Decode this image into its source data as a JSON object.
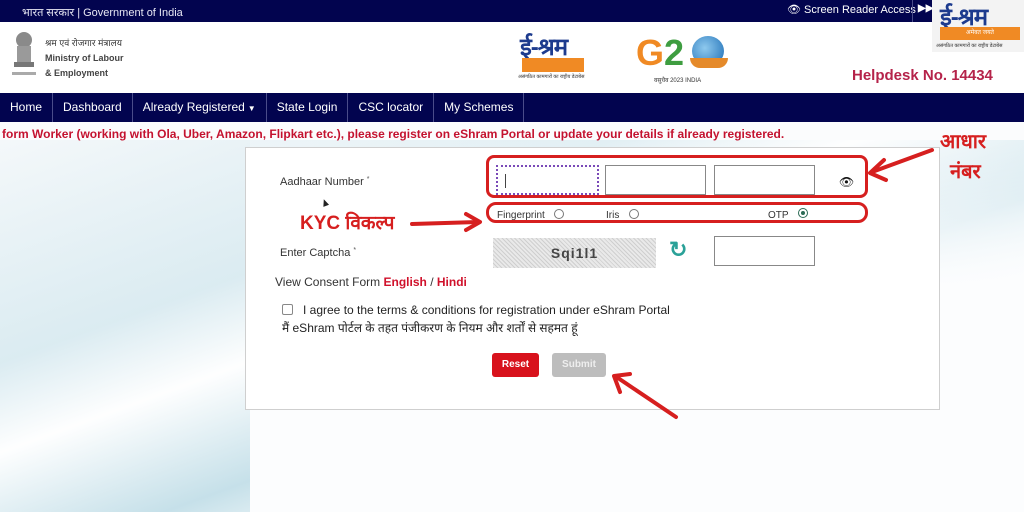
{
  "topbar": {
    "govt_label": "भारत सरकार | Government of India",
    "screen_reader_label": "Screen Reader Access",
    "skip_icon": "skip-forward-icon"
  },
  "header": {
    "ministry_hi": "श्रम एवं रोजगार मंत्रालय",
    "ministry_en_line1": "Ministry of Labour",
    "ministry_en_line2": "& Employment",
    "eshram_logo_text": "ई-श्रम",
    "eshram_tagline": "अमेवत जयते",
    "eshram_subtitle": "असंगठित कामगारों का राष्ट्रीय डेटाबेस",
    "g20_year": "वसुधैव 2023 INDIA",
    "helpdesk": "Helpdesk No. 14434"
  },
  "nav": {
    "items": [
      {
        "label": "Home"
      },
      {
        "label": "Dashboard"
      },
      {
        "label": "Already Registered",
        "has_dropdown": true
      },
      {
        "label": "State Login"
      },
      {
        "label": "CSC locator"
      },
      {
        "label": "My Schemes"
      }
    ]
  },
  "marquee": {
    "text": "form Worker (working with Ola, Uber, Amazon, Flipkart etc.), please register on eShram Portal or update your details if already registered."
  },
  "form": {
    "aadhaar_label": "Aadhaar Number",
    "required_mark": "*",
    "aadhaar_parts": [
      "",
      "",
      ""
    ],
    "kyc_options": [
      {
        "label": "Fingerprint",
        "selected": false
      },
      {
        "label": "Iris",
        "selected": false
      },
      {
        "label": "OTP",
        "selected": true
      }
    ],
    "captcha_label": "Enter Captcha",
    "captcha_text": "Sqi1l1",
    "captcha_value": "",
    "consent_prefix": "View Consent Form",
    "consent_english": "English",
    "consent_sep": "/",
    "consent_hindi": "Hindi",
    "agree_checked": false,
    "agree_en": "I agree to the terms & conditions for registration under eShram Portal",
    "agree_hi": "मैं eShram पोर्टल के तहत पंजीकरण के नियम और शर्तों से सहमत हूं",
    "reset_label": "Reset",
    "submit_label": "Submit"
  },
  "annotations": {
    "aadhaar_line1": "आधार",
    "aadhaar_line2": "नंबर",
    "kyc_label": "KYC विकल्प",
    "color": "#d61f1f"
  }
}
